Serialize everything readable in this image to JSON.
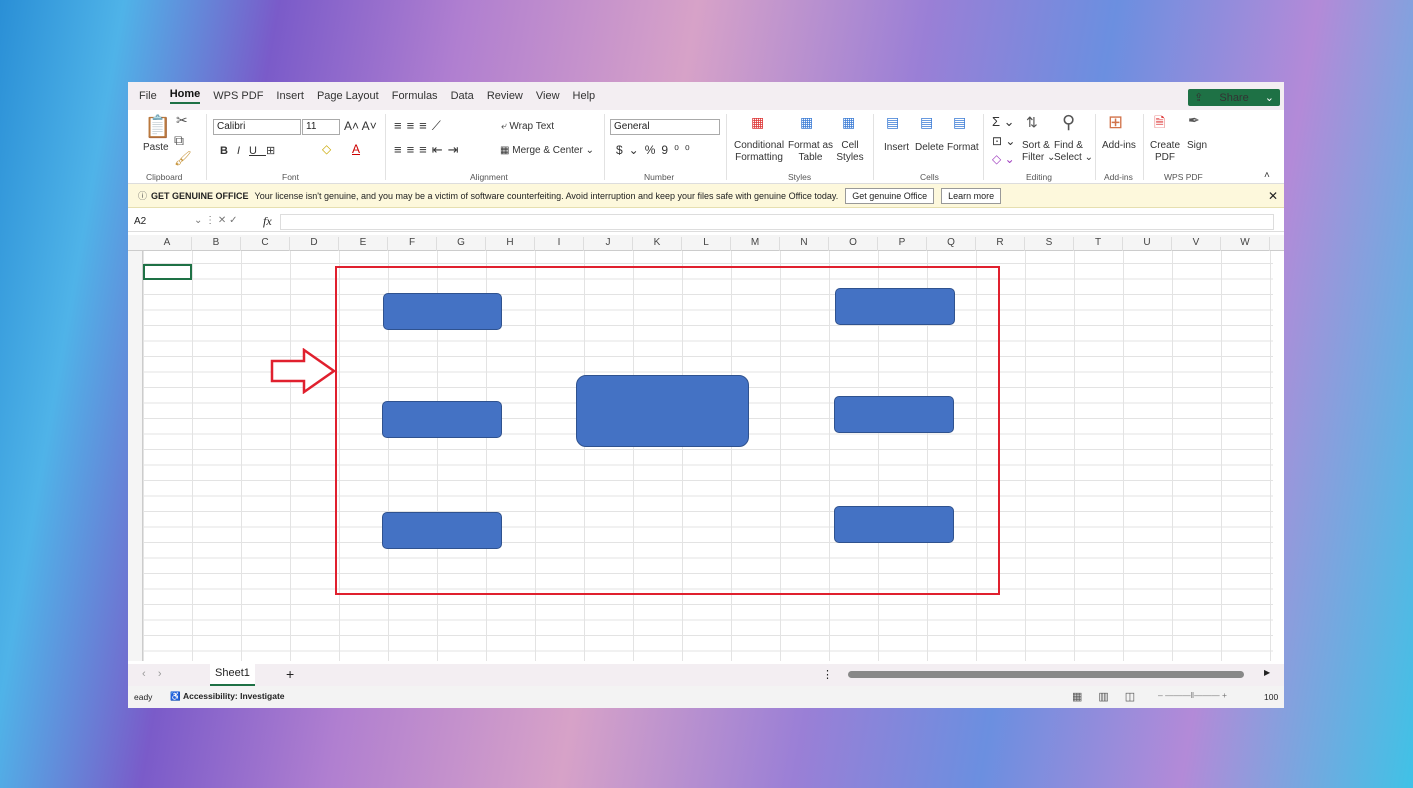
{
  "menu": {
    "items": [
      "File",
      "Home",
      "WPS PDF",
      "Insert",
      "Page Layout",
      "Formulas",
      "Data",
      "Review",
      "View",
      "Help"
    ],
    "share": "Share"
  },
  "ribbon": {
    "paste": "Paste",
    "font_name": "Calibri",
    "font_size": "11",
    "wrap_text": "Wrap Text",
    "merge_center": "Merge & Center",
    "number_format": "General",
    "cond_fmt_1": "Conditional",
    "cond_fmt_2": "Formatting",
    "fmt_table_1": "Format as",
    "fmt_table_2": "Table",
    "cell_styles_1": "Cell",
    "cell_styles_2": "Styles",
    "insert": "Insert",
    "delete": "Delete",
    "format": "Format",
    "sort_1": "Sort &",
    "sort_2": "Filter",
    "find_1": "Find &",
    "find_2": "Select",
    "addins": "Add-ins",
    "create_pdf_1": "Create",
    "create_pdf_2": "PDF",
    "sign": "Sign",
    "groups": [
      "Clipboard",
      "Font",
      "Alignment",
      "Number",
      "Styles",
      "Cells",
      "Editing",
      "Add-ins",
      "WPS PDF"
    ]
  },
  "warning": {
    "title": "GET GENUINE OFFICE",
    "message": "Your license isn't genuine, and you may be a victim of software counterfeiting. Avoid interruption and keep your files safe with genuine Office today.",
    "btn_genuine": "Get genuine Office",
    "btn_learn": "Learn more"
  },
  "formula_bar": {
    "name_box": "A2",
    "fx": "fx",
    "value": ""
  },
  "columns": [
    "A",
    "B",
    "C",
    "D",
    "E",
    "F",
    "G",
    "H",
    "I",
    "J",
    "K",
    "L",
    "M",
    "N",
    "O",
    "P",
    "Q",
    "R",
    "S",
    "T",
    "U",
    "V",
    "W"
  ],
  "sheet_tabs": {
    "active": "Sheet1",
    "add": "+"
  },
  "status": {
    "ready": "eady",
    "accessibility": "Accessibility: Investigate",
    "zoom": "100"
  },
  "colors": {
    "shape_fill": "#4472c4",
    "highlight_border": "#e0202e",
    "excel_green": "#1e7145"
  }
}
